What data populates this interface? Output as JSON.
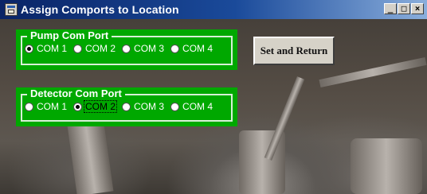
{
  "window": {
    "title": "Assign Comports to Location",
    "icon": "app-icon",
    "controls": {
      "minimize": "_",
      "maximize": "□",
      "close": "×"
    }
  },
  "pump_group": {
    "legend": "Pump Com Port",
    "options": [
      "COM 1",
      "COM 2",
      "COM 3",
      "COM 4"
    ],
    "selected": "COM 1"
  },
  "detector_group": {
    "legend": "Detector Com Port",
    "options": [
      "COM 1",
      "COM 2",
      "COM 3",
      "COM 4"
    ],
    "selected": "COM 2",
    "focused": "COM 2"
  },
  "set_return_button": {
    "label": "Set and Return"
  },
  "colors": {
    "group_bg": "#00a800",
    "titlebar_start": "#0a2466",
    "titlebar_end": "#8aaedc",
    "button_face": "#d6d2c8"
  }
}
